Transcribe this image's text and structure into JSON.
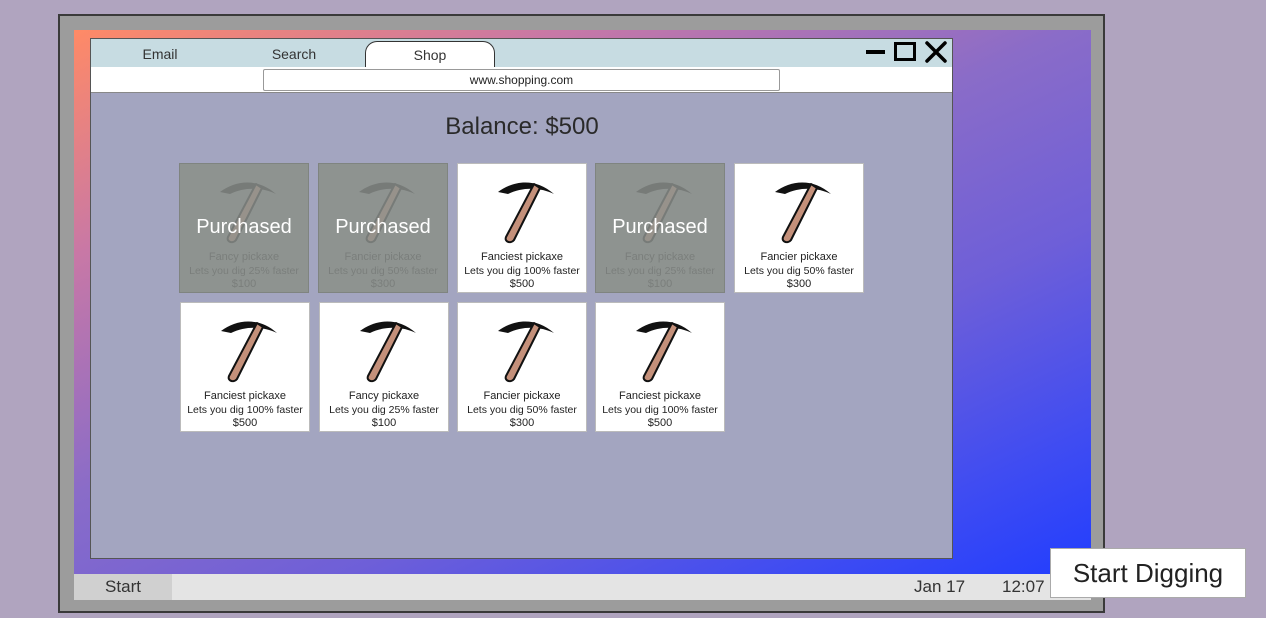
{
  "browser": {
    "tabs": [
      "Email",
      "Search",
      "Shop"
    ],
    "active_tab": "Shop",
    "url": "www.shopping.com"
  },
  "shop": {
    "balance_label": "Balance: $500",
    "purchased_label": "Purchased",
    "items": [
      {
        "name": "Fancy pickaxe",
        "desc": "Lets you dig 25% faster",
        "price": "$100",
        "purchased": true
      },
      {
        "name": "Fancier pickaxe",
        "desc": "Lets you dig 50% faster",
        "price": "$300",
        "purchased": true
      },
      {
        "name": "Fanciest pickaxe",
        "desc": "Lets you dig 100% faster",
        "price": "$500",
        "purchased": false
      },
      {
        "name": "Fancy pickaxe",
        "desc": "Lets you dig 25% faster",
        "price": "$100",
        "purchased": true
      },
      {
        "name": "Fancier pickaxe",
        "desc": "Lets you dig 50% faster",
        "price": "$300",
        "purchased": false
      },
      {
        "name": "Fanciest pickaxe",
        "desc": "Lets you dig 100% faster",
        "price": "$500",
        "purchased": false
      },
      {
        "name": "Fancy pickaxe",
        "desc": "Lets you dig 25% faster",
        "price": "$100",
        "purchased": false
      },
      {
        "name": "Fancier pickaxe",
        "desc": "Lets you dig 50% faster",
        "price": "$300",
        "purchased": false
      },
      {
        "name": "Fanciest pickaxe",
        "desc": "Lets you dig 100% faster",
        "price": "$500",
        "purchased": false
      }
    ]
  },
  "taskbar": {
    "start_label": "Start",
    "date": "Jan 17",
    "time": "12:07"
  },
  "start_digging_label": "Start Digging",
  "icons": {
    "item": "pickaxe-icon",
    "minimize": "minimize-icon",
    "maximize": "maximize-icon",
    "close": "close-icon"
  }
}
